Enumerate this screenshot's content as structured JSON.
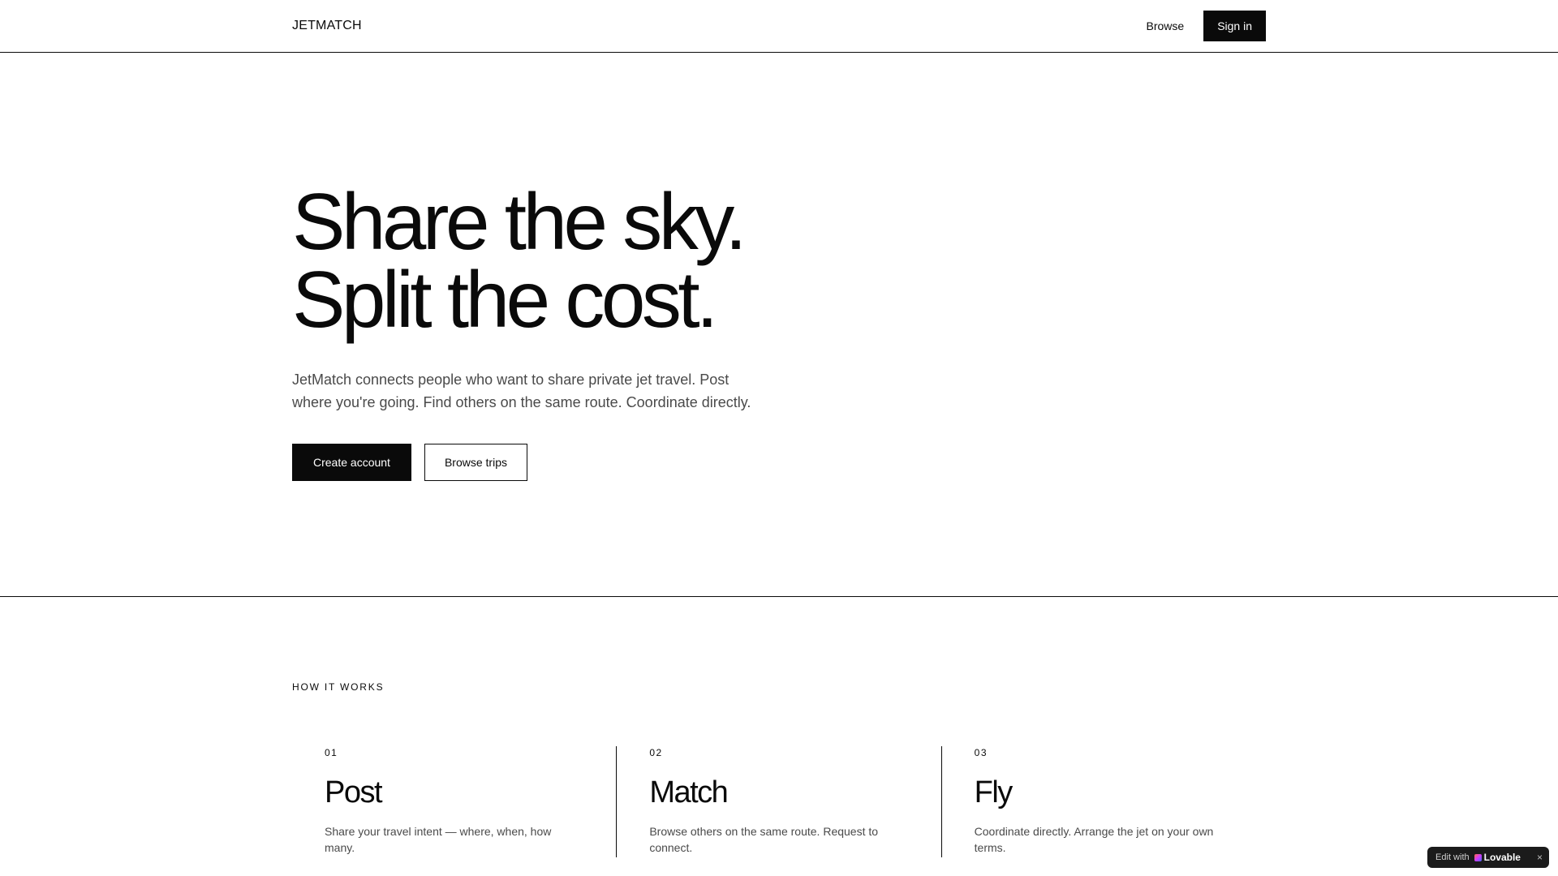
{
  "header": {
    "logo": "JETMATCH",
    "nav": {
      "browse": "Browse",
      "sign_in": "Sign in"
    }
  },
  "hero": {
    "title_line1": "Share the sky.",
    "title_line2": "Split the cost.",
    "description": "JetMatch connects people who want to share private jet travel. Post where you're going. Find others on the same route. Coordinate directly.",
    "primary_button": "Create account",
    "secondary_button": "Browse trips"
  },
  "how": {
    "label": "HOW IT WORKS",
    "steps": [
      {
        "num": "01",
        "title": "Post",
        "desc": "Share your travel intent — where, when, how many."
      },
      {
        "num": "02",
        "title": "Match",
        "desc": "Browse others on the same route. Request to connect."
      },
      {
        "num": "03",
        "title": "Fly",
        "desc": "Coordinate directly. Arrange the jet on your own terms."
      }
    ]
  },
  "badge": {
    "edit_with": "Edit with",
    "brand": "Lovable",
    "close": "×"
  }
}
